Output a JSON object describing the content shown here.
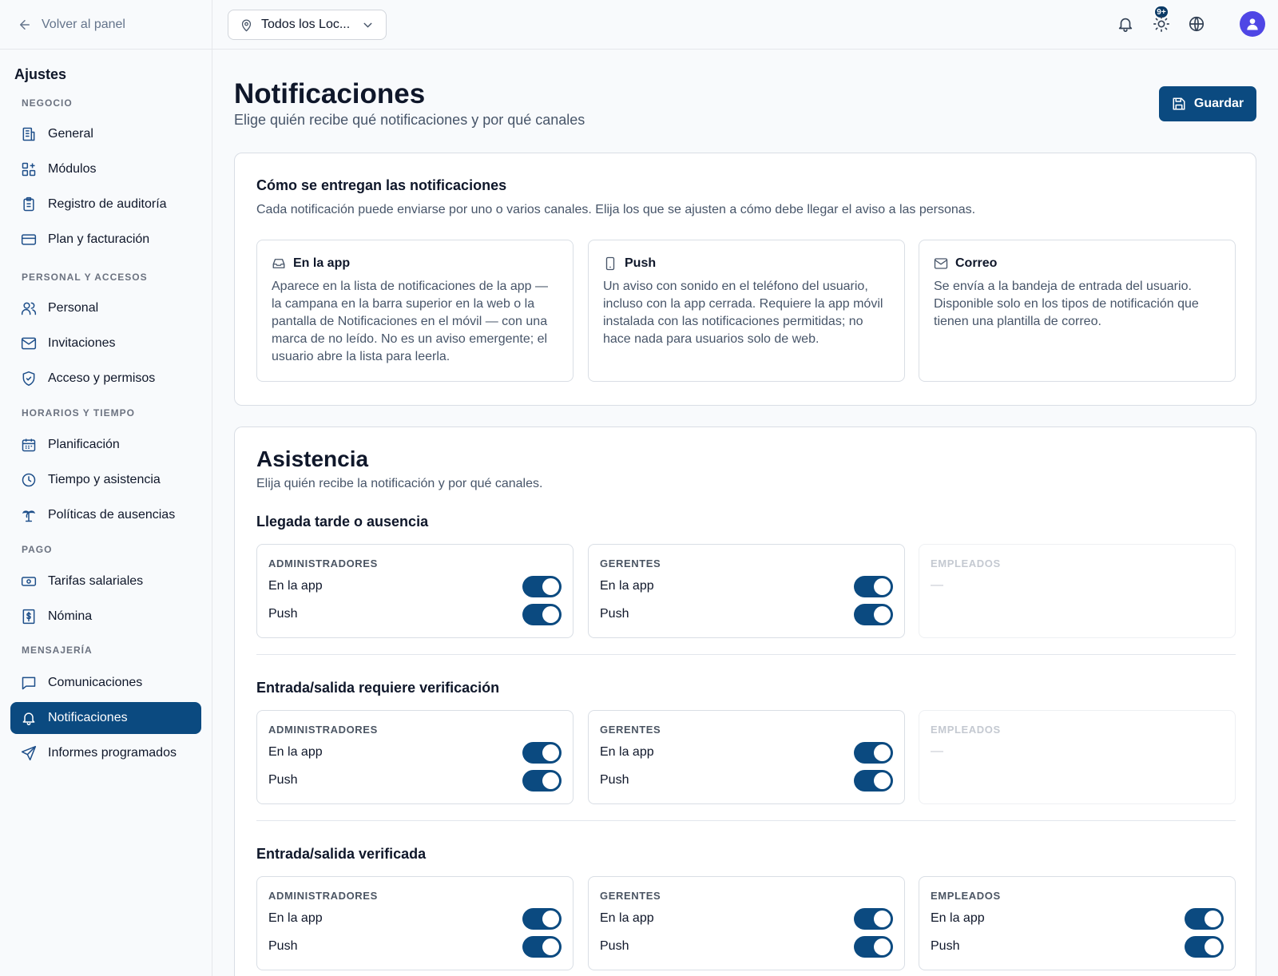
{
  "sidebar": {
    "back_label": "Volver al panel",
    "title": "Ajustes",
    "sections": {
      "negocio": "NEGOCIO",
      "personal": "PERSONAL Y ACCESOS",
      "horarios": "HORARIOS Y TIEMPO",
      "pago": "PAGO",
      "mensajeria": "MENSAJERÍA"
    },
    "items": {
      "general": "General",
      "modulos": "Módulos",
      "auditoria": "Registro de auditoría",
      "plan": "Plan y facturación",
      "personal": "Personal",
      "invitaciones": "Invitaciones",
      "acceso": "Acceso y permisos",
      "planificacion": "Planificación",
      "tiempo": "Tiempo y asistencia",
      "ausencias": "Políticas de ausencias",
      "tarifas": "Tarifas salariales",
      "nomina": "Nómina",
      "comunicaciones": "Comunicaciones",
      "notificaciones": "Notificaciones",
      "informes": "Informes programados"
    },
    "active_item": "notificaciones"
  },
  "topbar": {
    "location": "Todos los Loc...",
    "notification_badge": "9+",
    "icons": [
      "bell-icon",
      "sun-icon",
      "globe-icon",
      "user-icon"
    ]
  },
  "page": {
    "title": "Notificaciones",
    "subtitle": "Elige quién recibe qué notificaciones y por qué canales",
    "save_label": "Guardar"
  },
  "delivery": {
    "title": "Cómo se entregan las notificaciones",
    "description": "Cada notificación puede enviarse por uno o varios canales. Elija los que se ajusten a cómo debe llegar el aviso a las personas.",
    "channels": [
      {
        "name": "En la app",
        "icon": "inbox-icon",
        "text": "Aparece en la lista de notificaciones de la app — la campana en la barra superior en la web o la pantalla de Notificaciones en el móvil — con una marca de no leído. No es un aviso emergente; el usuario abre la lista para leerla."
      },
      {
        "name": "Push",
        "icon": "phone-icon",
        "text": "Un aviso con sonido en el teléfono del usuario, incluso con la app cerrada. Requiere la app móvil instalada con las notificaciones permitidas; no hace nada para usuarios solo de web."
      },
      {
        "name": "Correo",
        "icon": "mail-icon",
        "text": "Se envía a la bandeja de entrada del usuario. Disponible solo en los tipos de notificación que tienen una plantilla de correo."
      }
    ]
  },
  "attendance": {
    "title": "Asistencia",
    "description": "Elija quién recibe la notificación y por qué canales.",
    "roles": {
      "admin": "ADMINISTRADORES",
      "managers": "GERENTES",
      "employees": "EMPLEADOS"
    },
    "channel_labels": {
      "app": "En la app",
      "push": "Push"
    },
    "empty_dash": "—",
    "events": [
      {
        "title": "Llegada tarde o ausencia",
        "admin": {
          "app": true,
          "push": true
        },
        "managers": {
          "app": true,
          "push": true
        },
        "employees": null
      },
      {
        "title": "Entrada/salida requiere verificación",
        "admin": {
          "app": true,
          "push": true
        },
        "managers": {
          "app": true,
          "push": true
        },
        "employees": null
      },
      {
        "title": "Entrada/salida verificada",
        "admin": {
          "app": true,
          "push": true
        },
        "managers": {
          "app": true,
          "push": true
        },
        "employees": {
          "app": true,
          "push": true
        }
      }
    ]
  },
  "colors": {
    "accent": "#0b4a80",
    "avatar": "#4f46e5"
  }
}
